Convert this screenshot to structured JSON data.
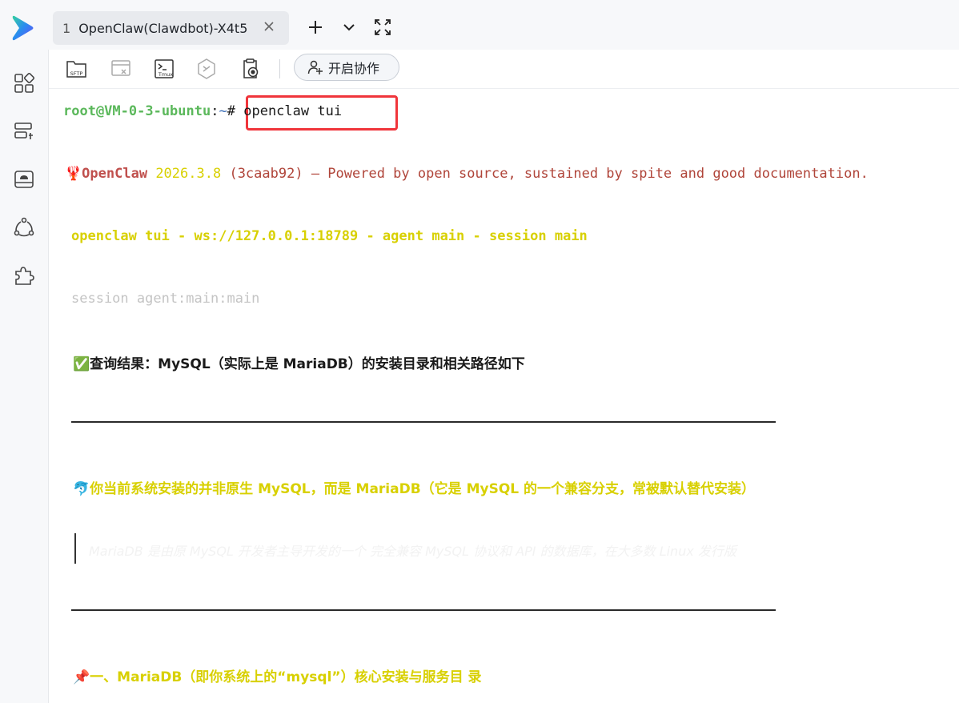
{
  "titlebar": {
    "tab": {
      "index": "1",
      "title": "OpenClaw(Clawdbot)-X4t5"
    },
    "icons": [
      "app-logo-icon",
      "close-icon",
      "plus-icon",
      "chevron-down-icon",
      "fullscreen-icon"
    ]
  },
  "sidebar": {
    "items": [
      "apps-icon",
      "server-list-icon",
      "cloud-drive-icon",
      "share-network-icon",
      "plugin-icon"
    ]
  },
  "toolbar": {
    "sftp_label": "SFTP",
    "tmux_label": "Tmux",
    "collab_label": "开启协作"
  },
  "terminal": {
    "prompt_user": "root@VM-0-3-ubuntu",
    "prompt_sep": ":",
    "prompt_path": "~",
    "prompt_hash": "#",
    "command": "openclaw tui",
    "banner": {
      "emoji": "🦞",
      "name": "OpenClaw",
      "version": "2026.3.8",
      "commit": "(3caab92)",
      "tagline": "— Powered by open source, sustained by spite and good documentation."
    },
    "status_line": "openclaw tui - ws://127.0.0.1:18789 - agent main - session main",
    "session_line": "session agent:main:main",
    "result_emoji": "✅",
    "result_heading": "查询结果：MySQL（实际上是 MariaDB）的安装目录和相关路径如下",
    "note_emoji": "🐬",
    "note_text": "你当前系统安装的并非原生 MySQL，而是 MariaDB（它是 MySQL 的一个兼容分支，常被默认替代安装）",
    "quote_text": "MariaDB 是由原 MySQL 开发者主导开发的一个 完全兼容 MySQL 协议和 API 的数据库，在大多数 Linux 发行版",
    "section_emoji": "📌",
    "section_heading": "一、MariaDB（即你系统上的“mysql”）核心安装与服务目 录"
  }
}
